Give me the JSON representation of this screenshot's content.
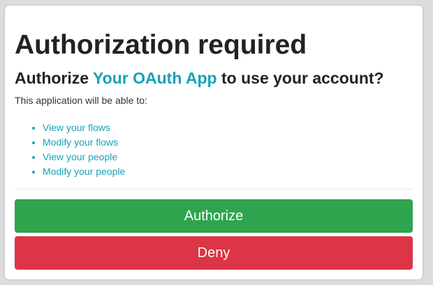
{
  "auth": {
    "title": "Authorization required",
    "subtitle_prefix": "Authorize ",
    "app_name": "Your OAuth App",
    "subtitle_suffix": " to use your account?",
    "intro": "This application will be able to:",
    "permissions": [
      "View your flows",
      "Modify your flows",
      "View your people",
      "Modify your people"
    ],
    "authorize_label": "Authorize",
    "deny_label": "Deny"
  },
  "colors": {
    "link": "#17a2b8",
    "authorize": "#2ea44f",
    "deny": "#dc3545"
  }
}
